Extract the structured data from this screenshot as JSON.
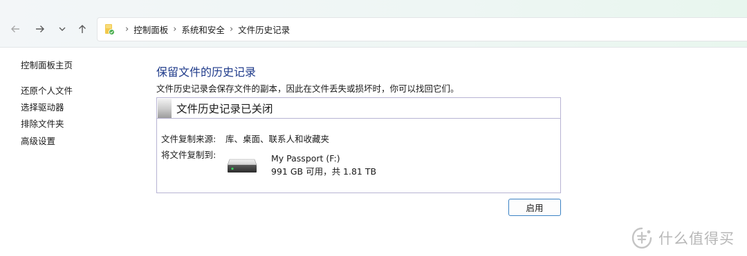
{
  "navigation": {
    "breadcrumbs": [
      "控制面板",
      "系统和安全",
      "文件历史记录"
    ]
  },
  "sidebar": {
    "items": [
      {
        "label": "控制面板主页"
      },
      {
        "label": "还原个人文件"
      },
      {
        "label": "选择驱动器"
      },
      {
        "label": "排除文件夹"
      },
      {
        "label": "高级设置"
      }
    ]
  },
  "main": {
    "title": "保留文件的历史记录",
    "description": "文件历史记录会保存文件的副本，因此在文件丢失或损坏时，你可以找回它们。",
    "status": {
      "heading": "文件历史记录已关闭",
      "source_label": "文件复制来源:",
      "source_value": "库、桌面、联系人和收藏夹",
      "target_label": "将文件复制到:",
      "drive_name": "My Passport (F:)",
      "drive_space": "991 GB 可用，共 1.81 TB"
    },
    "enable_button": "启用"
  },
  "watermark": {
    "text": "什么值得买"
  },
  "colors": {
    "title_blue": "#1e3a8a",
    "box_border": "#b7b3d3",
    "button_border": "#3b82c4"
  },
  "icons": {
    "back": "arrow-left-icon",
    "forward": "arrow-right-icon",
    "recent": "chevron-down-icon",
    "up": "arrow-up-icon",
    "location": "control-panel-icon",
    "drive": "hard-drive-icon"
  }
}
